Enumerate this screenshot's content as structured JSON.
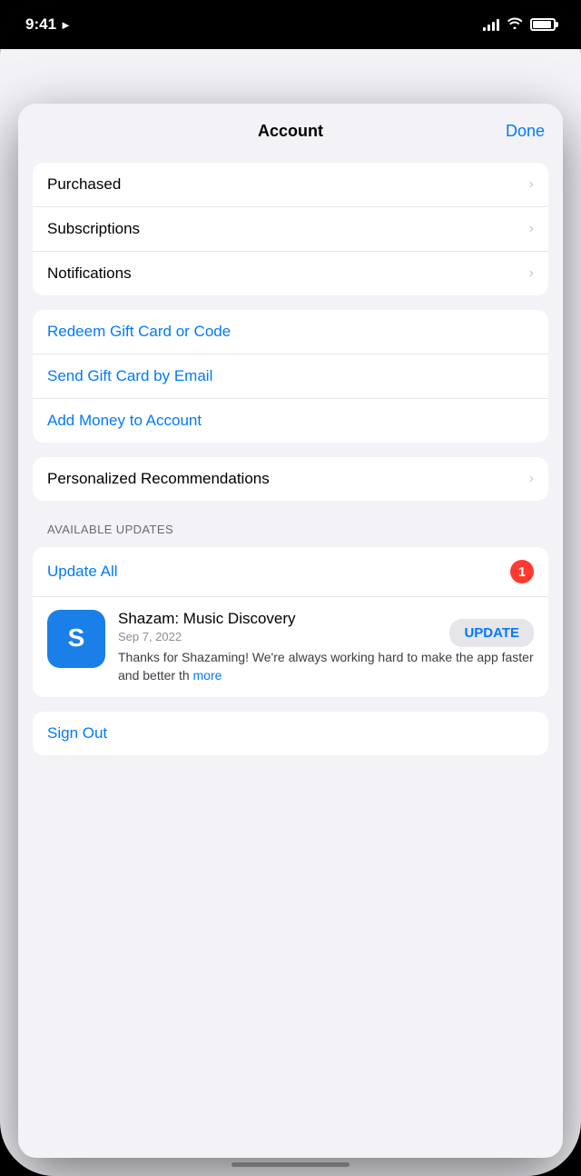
{
  "status_bar": {
    "time": "9:41",
    "location_icon": "▶",
    "battery_level": 90
  },
  "modal": {
    "title": "Account",
    "done_label": "Done"
  },
  "first_section": {
    "items": [
      {
        "label": "Purchased",
        "has_chevron": true
      },
      {
        "label": "Subscriptions",
        "has_chevron": true
      },
      {
        "label": "Notifications",
        "has_chevron": true
      }
    ]
  },
  "gift_section": {
    "items": [
      {
        "label": "Redeem Gift Card or Code",
        "is_blue": true,
        "has_chevron": false
      },
      {
        "label": "Send Gift Card by Email",
        "is_blue": true,
        "has_chevron": false
      },
      {
        "label": "Add Money to Account",
        "is_blue": true,
        "has_chevron": false
      }
    ]
  },
  "recommendations": {
    "label": "Personalized Recommendations",
    "has_chevron": true
  },
  "available_updates": {
    "section_label": "AVAILABLE UPDATES",
    "update_all_label": "Update All",
    "badge_count": "1",
    "app": {
      "name": "Shazam: Music Discovery",
      "date": "Sep 7, 2022",
      "description": "Thanks for Shazaming! We're always working hard to make the app faster and better th",
      "more_label": "more",
      "update_button_label": "UPDATE"
    }
  },
  "sign_out": {
    "label": "Sign Out"
  }
}
